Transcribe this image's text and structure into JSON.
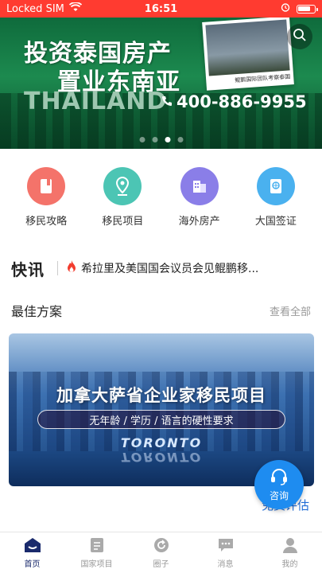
{
  "status_bar": {
    "carrier": "Locked SIM",
    "time": "16:51",
    "battery_level": 0.8
  },
  "banner": {
    "headline_line1": "投资泰国房产",
    "headline_line2": "置业东南亚",
    "country": "THAILAND",
    "phone": "400-886-9955",
    "photo_caption": "鲲鹏国际团队考察泰国",
    "slide_count": 4,
    "active_slide": 3
  },
  "quick_nav": [
    {
      "label": "移民攻略",
      "icon": "book-icon",
      "color": "#f4736a"
    },
    {
      "label": "移民项目",
      "icon": "location-pin-icon",
      "color": "#4cc5b4"
    },
    {
      "label": "海外房产",
      "icon": "building-icon",
      "color": "#8a7ee8"
    },
    {
      "label": "大国签证",
      "icon": "passport-icon",
      "color": "#4ab1ef"
    }
  ],
  "news": {
    "logo": "快讯",
    "headline": "希拉里及美国国会议员会见鲲鹏移..."
  },
  "best_plans": {
    "title": "最佳方案",
    "more_label": "查看全部",
    "card": {
      "title": "加拿大萨省企业家移民项目",
      "subtitle": "无年龄 / 学历 / 语言的硬性要求",
      "sign": "TORONTO"
    }
  },
  "eval_link": "免费评估",
  "consult_label": "咨询",
  "tabs": [
    {
      "label": "首页",
      "icon": "home-icon",
      "active": true
    },
    {
      "label": "国家项目",
      "icon": "document-icon",
      "active": false
    },
    {
      "label": "圈子",
      "icon": "refresh-icon",
      "active": false
    },
    {
      "label": "消息",
      "icon": "chat-icon",
      "active": false
    },
    {
      "label": "我的",
      "icon": "user-icon",
      "active": false
    }
  ],
  "colors": {
    "status_bar": "#ff3b30",
    "accent": "#1e8cf0",
    "tab_active": "#1a2a6c"
  }
}
